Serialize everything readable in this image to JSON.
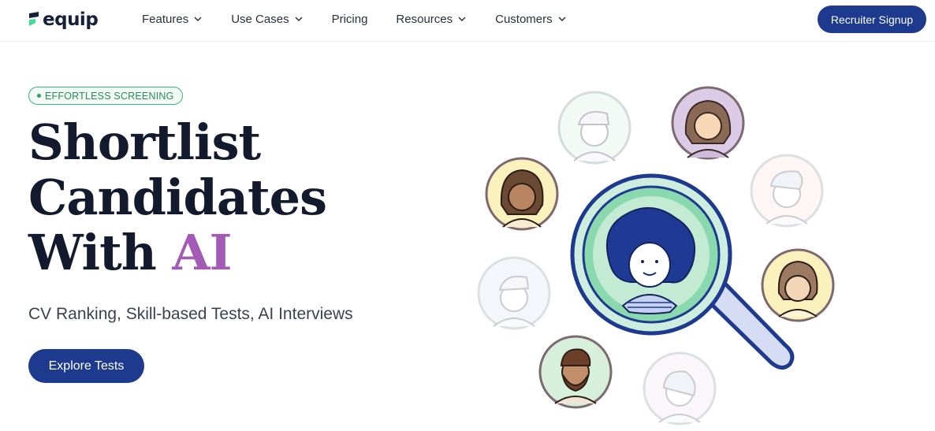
{
  "nav": {
    "logo_text": "equip",
    "items": [
      {
        "label": "Features",
        "dropdown": true
      },
      {
        "label": "Use Cases",
        "dropdown": true
      },
      {
        "label": "Pricing",
        "dropdown": false
      },
      {
        "label": "Resources",
        "dropdown": true
      },
      {
        "label": "Customers",
        "dropdown": true
      }
    ],
    "signup_label": "Recruiter Signup"
  },
  "hero": {
    "badge": "EFFORTLESS SCREENING",
    "headline_lines": [
      "Shortlist",
      "Candidates",
      "With "
    ],
    "headline_accent": "AI",
    "subtitle": "CV Ranking, Skill-based Tests, AI Interviews",
    "cta_label": "Explore Tests"
  },
  "colors": {
    "brand_blue": "#1d3a8f",
    "accent_purple": "#a35bb6",
    "badge_green": "#3fb282",
    "logo_green": "#3ddc97"
  }
}
